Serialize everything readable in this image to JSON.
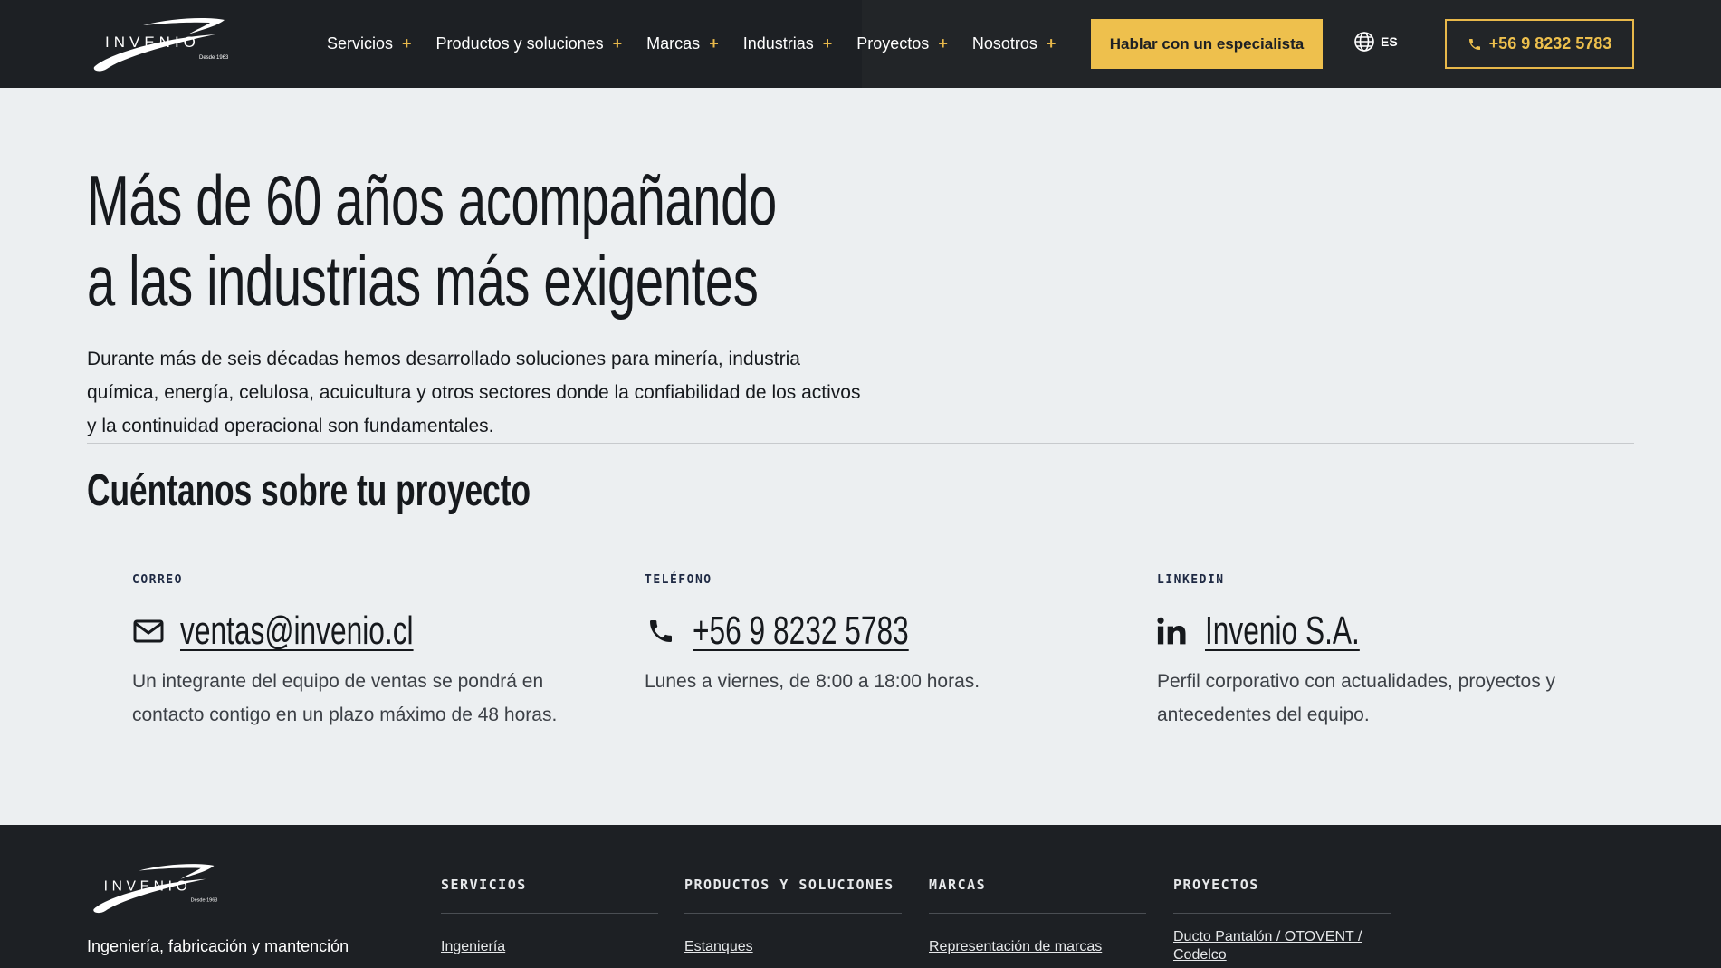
{
  "header": {
    "logo_text": "INVENIO",
    "logo_since": "Desde 1963",
    "nav": [
      {
        "label": "Servicios"
      },
      {
        "label": "Productos y soluciones"
      },
      {
        "label": "Marcas"
      },
      {
        "label": "Industrias"
      },
      {
        "label": "Proyectos"
      },
      {
        "label": "Nosotros"
      }
    ],
    "nav_expand_symbol": "+",
    "cta_label": "Hablar con un especialista",
    "language": "ES",
    "phone": "+56 9 8232 5783"
  },
  "hero": {
    "title_line1": "Más de 60 años acompañando",
    "title_line2": "a las industrias más exigentes",
    "text": "Durante más de seis décadas hemos desarrollado soluciones para minería, industria química, energía, celulosa, acuicultura y otros sectores donde la confiabilidad de los activos y la continuidad operacional son fundamentales."
  },
  "contact": {
    "title": "Cuéntanos sobre tu proyecto",
    "cards": [
      {
        "label": "CORREO",
        "value": "ventas@invenio.cl",
        "icon": "mail-icon",
        "description": "Un integrante del equipo de ventas se pondrá en contacto contigo en un plazo máximo de 48 horas."
      },
      {
        "label": "TELÉFONO",
        "value": "+56 9 8232 5783",
        "icon": "phone-icon",
        "description": "Lunes a viernes, de 8:00 a 18:00 horas."
      },
      {
        "label": "LINKEDIN",
        "value": "Invenio S.A.",
        "icon": "linkedin-icon",
        "description": "Perfil corporativo con actualidades, proyectos y antecedentes del equipo."
      }
    ]
  },
  "footer": {
    "tagline": "Ingeniería, fabricación y mantención",
    "columns": [
      {
        "heading": "SERVICIOS",
        "link": "Ingeniería"
      },
      {
        "heading": "PRODUCTOS Y SOLUCIONES",
        "link": "Estanques"
      },
      {
        "heading": "MARCAS",
        "link": "Representación de marcas"
      },
      {
        "heading": "PROYECTOS",
        "link": "Ducto Pantalón / OTOVENT / Codelco"
      }
    ]
  },
  "colors": {
    "header_bg": "#1d2024",
    "accent": "#eec04d",
    "page_bg": "#eceff1",
    "text": "#16191d"
  }
}
